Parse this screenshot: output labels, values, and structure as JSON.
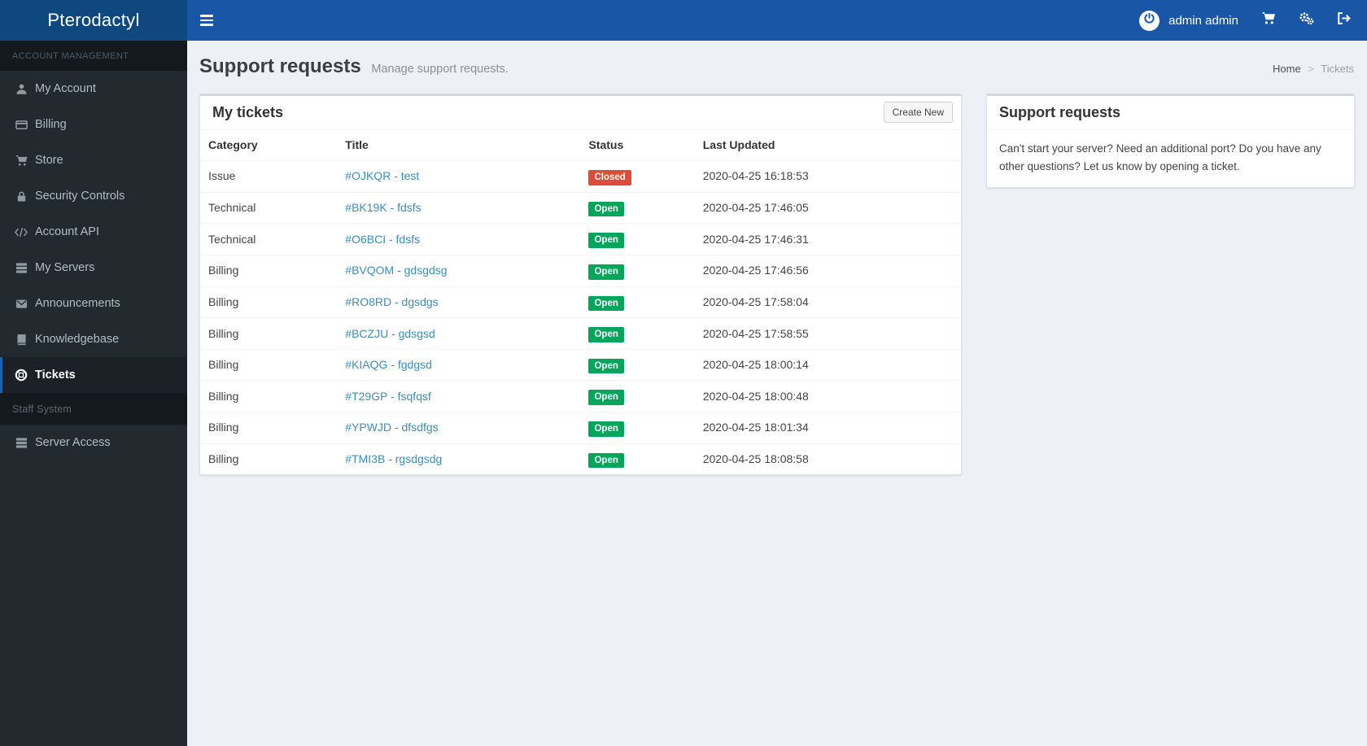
{
  "brand": "Pterodactyl",
  "navbar": {
    "hamburger_icon": "hamburger-icon",
    "user": {
      "name": "admin admin",
      "avatar_icon": "power-icon"
    },
    "action_icons": [
      "cart-icon",
      "cogs-icon",
      "sign-out-icon"
    ]
  },
  "sidebar": {
    "sections": [
      {
        "label": "ACCOUNT MANAGEMENT",
        "items": [
          {
            "label": "My Account",
            "icon": "user-icon"
          },
          {
            "label": "Billing",
            "icon": "credit-card-icon"
          },
          {
            "label": "Store",
            "icon": "cart-icon"
          },
          {
            "label": "Security Controls",
            "icon": "lock-icon"
          },
          {
            "label": "Account API",
            "icon": "code-icon"
          },
          {
            "label": "My Servers",
            "icon": "server-icon"
          },
          {
            "label": "Announcements",
            "icon": "envelope-icon"
          },
          {
            "label": "Knowledgebase",
            "icon": "book-icon"
          },
          {
            "label": "Tickets",
            "icon": "life-ring-icon",
            "active": true
          }
        ]
      },
      {
        "label": "Staff System",
        "items": [
          {
            "label": "Server Access",
            "icon": "server-icon"
          }
        ]
      }
    ]
  },
  "page_header": {
    "title": "Support requests",
    "subtitle": "Manage support requests.",
    "breadcrumb": {
      "home": "Home",
      "separator": ">",
      "current": "Tickets"
    }
  },
  "tickets_panel": {
    "title": "My tickets",
    "create_button_label": "Create New",
    "columns": {
      "category": "Category",
      "title": "Title",
      "status": "Status",
      "updated": "Last Updated"
    },
    "status_colors": {
      "Open": "#00a65a",
      "Closed": "#dd4b39"
    },
    "rows": [
      {
        "category": "Issue",
        "title": "#OJKQR - test",
        "status": "Closed",
        "updated": "2020-04-25 16:18:53"
      },
      {
        "category": "Technical",
        "title": "#BK19K - fdsfs",
        "status": "Open",
        "updated": "2020-04-25 17:46:05"
      },
      {
        "category": "Technical",
        "title": "#O6BCI - fdsfs",
        "status": "Open",
        "updated": "2020-04-25 17:46:31"
      },
      {
        "category": "Billing",
        "title": "#BVQOM - gdsgdsg",
        "status": "Open",
        "updated": "2020-04-25 17:46:56"
      },
      {
        "category": "Billing",
        "title": "#RO8RD - dgsdgs",
        "status": "Open",
        "updated": "2020-04-25 17:58:04"
      },
      {
        "category": "Billing",
        "title": "#BCZJU - gdsgsd",
        "status": "Open",
        "updated": "2020-04-25 17:58:55"
      },
      {
        "category": "Billing",
        "title": "#KIAQG - fgdgsd",
        "status": "Open",
        "updated": "2020-04-25 18:00:14"
      },
      {
        "category": "Billing",
        "title": "#T29GP - fsqfqsf",
        "status": "Open",
        "updated": "2020-04-25 18:00:48"
      },
      {
        "category": "Billing",
        "title": "#YPWJD - dfsdfgs",
        "status": "Open",
        "updated": "2020-04-25 18:01:34"
      },
      {
        "category": "Billing",
        "title": "#TMI3B - rgsdgsdg",
        "status": "Open",
        "updated": "2020-04-25 18:08:58"
      }
    ]
  },
  "info_panel": {
    "title": "Support requests",
    "body": "Can't start your server? Need an additional port? Do you have any other questions? Let us know by opening a ticket."
  },
  "colors": {
    "navbar": "#1956a6",
    "logo_bg": "#0f487f",
    "sidebar_bg": "#222a30",
    "active_accent": "#1f63b0",
    "link": "#3c8dbc",
    "open_badge": "#00a65a",
    "closed_badge": "#dd4b39",
    "content_bg": "#edf0f4"
  }
}
